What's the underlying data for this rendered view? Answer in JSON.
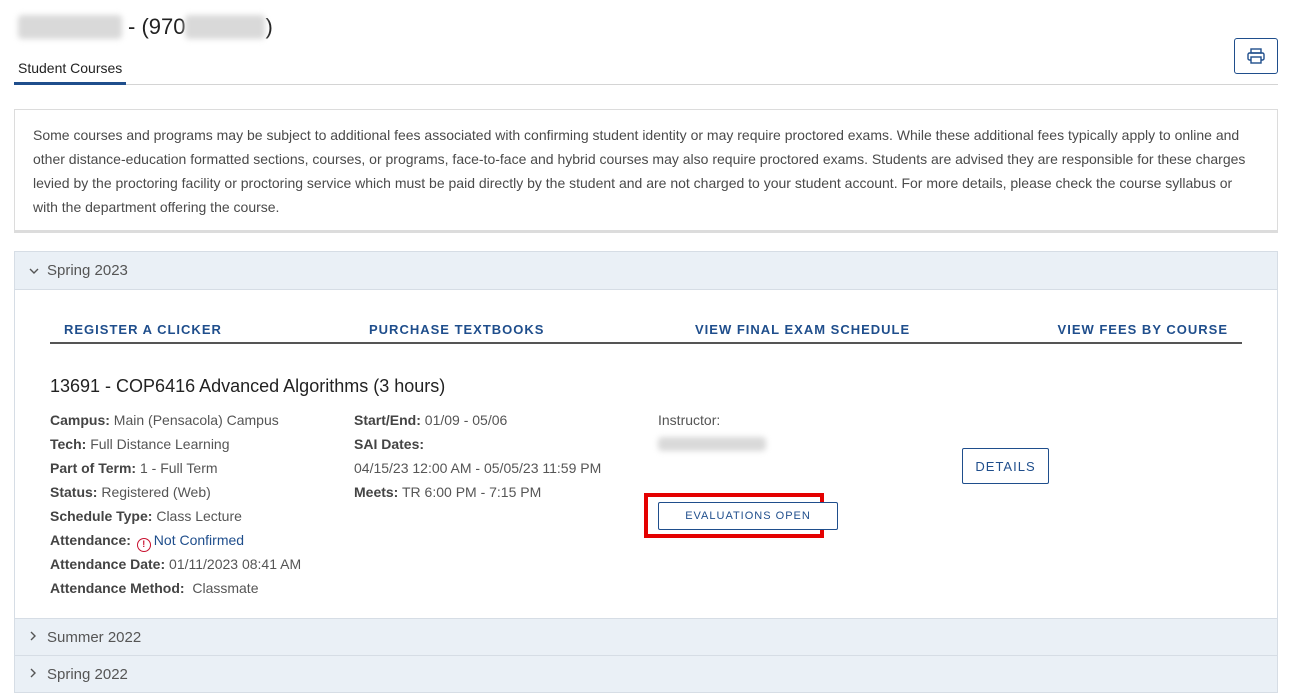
{
  "header": {
    "name_suffix": "- (970",
    "id_close": ")",
    "tab_label": "Student Courses",
    "print_icon": "printer-icon"
  },
  "notice": {
    "text": "Some courses and programs may be subject to additional fees associated with confirming student identity or may require proctored exams. While these additional fees typically apply to online and other distance-education formatted sections, courses, or programs, face-to-face and hybrid courses may also require proctored exams. Students are advised they are responsible for these charges levied by the proctoring facility or proctoring service which must be paid directly by the student and are not charged to your student account. For more details, please check the course syllabus or with the department offering the course."
  },
  "terms": [
    {
      "label": "Spring 2023",
      "expanded": true,
      "links": [
        "REGISTER A CLICKER",
        "PURCHASE TEXTBOOKS",
        "VIEW FINAL EXAM SCHEDULE",
        "VIEW FEES BY COURSE"
      ],
      "course": {
        "title": "13691 - COP6416 Advanced Algorithms (3 hours)",
        "campus_label": "Campus:",
        "campus": "Main (Pensacola) Campus",
        "tech_label": "Tech:",
        "tech": "Full Distance Learning",
        "part_label": "Part of Term:",
        "part": "1 - Full Term",
        "status_label": "Status:",
        "status": "Registered (Web)",
        "schedule_label": "Schedule Type:",
        "schedule": "Class Lecture",
        "attendance_label": "Attendance:",
        "attendance": "Not Confirmed",
        "attendance_date_label": "Attendance Date:",
        "attendance_date": "01/11/2023 08:41 AM",
        "attendance_method_label": "Attendance Method:",
        "attendance_method": "Classmate",
        "startend_label": "Start/End:",
        "startend": "01/09 - 05/06",
        "sai_label": "SAI Dates:",
        "sai": "04/15/23 12:00 AM - 05/05/23 11:59 PM",
        "meets_label": "Meets:",
        "meets": "TR 6:00 PM - 7:15 PM",
        "instructor_label": "Instructor:",
        "evaluations_button": "EVALUATIONS OPEN",
        "details_button": "DETAILS"
      }
    },
    {
      "label": "Summer 2022",
      "expanded": false
    },
    {
      "label": "Spring 2022",
      "expanded": false
    }
  ],
  "colors": {
    "accent": "#1f4e8c",
    "highlight": "#e40000",
    "panel": "#eaf0f6"
  }
}
